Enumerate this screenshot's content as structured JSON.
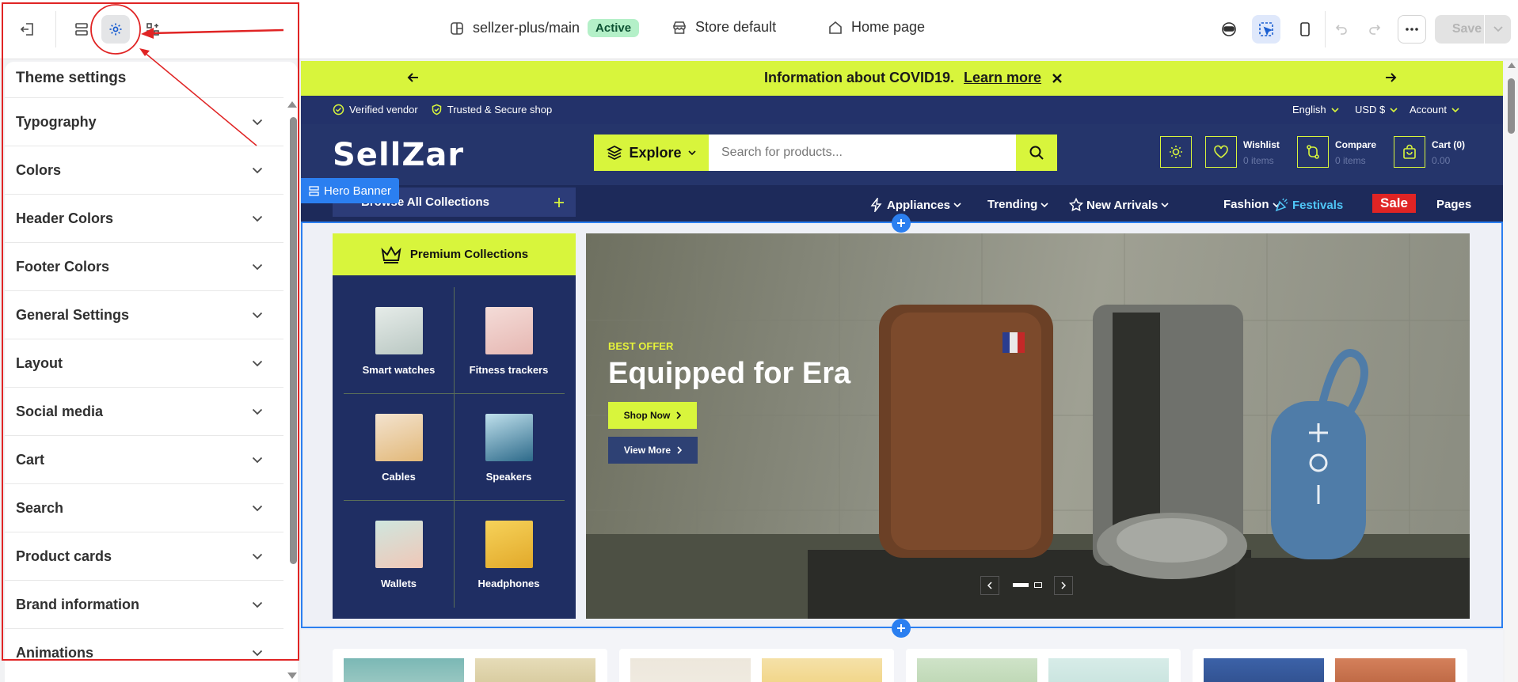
{
  "topbar": {
    "theme_name": "sellzer-plus/main",
    "theme_status": "Active",
    "store_label": "Store default",
    "page_label": "Home page",
    "save_label": "Save"
  },
  "sidebar": {
    "title": "Theme settings",
    "sections": [
      {
        "label": "Typography"
      },
      {
        "label": "Colors"
      },
      {
        "label": "Header Colors"
      },
      {
        "label": "Footer Colors"
      },
      {
        "label": "General Settings"
      },
      {
        "label": "Layout"
      },
      {
        "label": "Social media"
      },
      {
        "label": "Cart"
      },
      {
        "label": "Search"
      },
      {
        "label": "Product cards"
      },
      {
        "label": "Brand information"
      },
      {
        "label": "Animations"
      }
    ]
  },
  "preview": {
    "announcement": {
      "text": "Information about COVID19.",
      "link": "Learn more"
    },
    "util": {
      "verified": "Verified vendor",
      "trusted": "Trusted & Secure shop",
      "language": "English",
      "currency": "USD $",
      "account": "Account"
    },
    "header": {
      "logo": "SellZar",
      "explore": "Explore",
      "search_placeholder": "Search for products...",
      "wishlist_label": "Wishlist",
      "wishlist_count": "0 items",
      "compare_label": "Compare",
      "compare_count": "0 items",
      "cart_label": "Cart (0)",
      "cart_total": "0.00"
    },
    "nav": {
      "browse": "Browse All Collections",
      "section_tag": "Hero Banner",
      "items": [
        "Appliances",
        "Trending",
        "New Arrivals",
        "Fashion",
        "Festivals",
        "Sale",
        "Pages"
      ]
    },
    "collections": {
      "title": "Premium Collections",
      "items": [
        {
          "label": "Smart watches"
        },
        {
          "label": "Fitness trackers"
        },
        {
          "label": "Cables"
        },
        {
          "label": "Speakers"
        },
        {
          "label": "Wallets"
        },
        {
          "label": "Headphones"
        }
      ]
    },
    "banner": {
      "eyebrow": "BEST OFFER",
      "heading": "Equipped for Era",
      "primary_btn": "Shop Now",
      "secondary_btn": "View More"
    }
  },
  "colors": {
    "accent_lime": "#d8f53c",
    "navy": "#23326a",
    "editor_blue": "#2b7ff0",
    "annotation_red": "#e02424"
  }
}
